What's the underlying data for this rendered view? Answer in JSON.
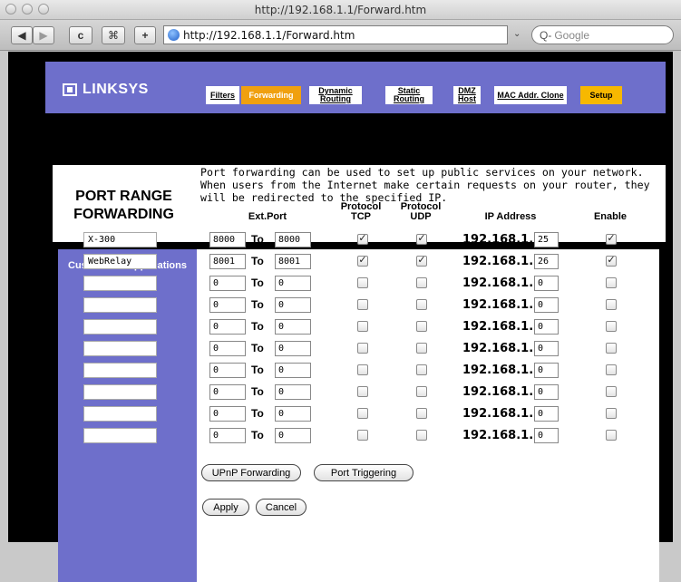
{
  "browser": {
    "title": "http://192.168.1.1/Forward.htm",
    "url": "http://192.168.1.1/Forward.htm",
    "search_placeholder": "Google",
    "buttons": {
      "back": "◀",
      "forward": "▶",
      "reload": "c",
      "bookmark": "⌘",
      "add": "+"
    }
  },
  "brand": {
    "logo_text": "LINKSYS"
  },
  "tabs": [
    {
      "label": "Filters"
    },
    {
      "label": "Forwarding"
    },
    {
      "label": "Dynamic Routing"
    },
    {
      "label": "Static Routing"
    },
    {
      "label": "DMZ Host"
    },
    {
      "label": "MAC Addr. Clone"
    },
    {
      "label": "Setup"
    }
  ],
  "page": {
    "title_line1": "PORT RANGE",
    "title_line2": "FORWARDING",
    "description": "Port forwarding can be used to set up public services on your network. When users from the Internet make certain requests on your router, they will be redirected to the specified IP."
  },
  "table": {
    "side_label": "Customized Applications",
    "headers": {
      "ext_port": "Ext.Port",
      "tcp_line1": "Protocol",
      "tcp_line2": "TCP",
      "udp_line1": "Protocol",
      "udp_line2": "UDP",
      "ip": "IP Address",
      "enable": "Enable"
    },
    "to_label": "To",
    "ip_prefix": "192.168.1.",
    "rows": [
      {
        "app": "X-300",
        "from": "8000",
        "to": "8000",
        "tcp": true,
        "udp": true,
        "ip": "25",
        "enable": true
      },
      {
        "app": "WebRelay",
        "from": "8001",
        "to": "8001",
        "tcp": true,
        "udp": true,
        "ip": "26",
        "enable": true
      },
      {
        "app": "",
        "from": "0",
        "to": "0",
        "tcp": false,
        "udp": false,
        "ip": "0",
        "enable": false
      },
      {
        "app": "",
        "from": "0",
        "to": "0",
        "tcp": false,
        "udp": false,
        "ip": "0",
        "enable": false
      },
      {
        "app": "",
        "from": "0",
        "to": "0",
        "tcp": false,
        "udp": false,
        "ip": "0",
        "enable": false
      },
      {
        "app": "",
        "from": "0",
        "to": "0",
        "tcp": false,
        "udp": false,
        "ip": "0",
        "enable": false
      },
      {
        "app": "",
        "from": "0",
        "to": "0",
        "tcp": false,
        "udp": false,
        "ip": "0",
        "enable": false
      },
      {
        "app": "",
        "from": "0",
        "to": "0",
        "tcp": false,
        "udp": false,
        "ip": "0",
        "enable": false
      },
      {
        "app": "",
        "from": "0",
        "to": "0",
        "tcp": false,
        "udp": false,
        "ip": "0",
        "enable": false
      },
      {
        "app": "",
        "from": "0",
        "to": "0",
        "tcp": false,
        "udp": false,
        "ip": "0",
        "enable": false
      }
    ]
  },
  "actions": {
    "upnp": "UPnP Forwarding",
    "port_triggering": "Port Triggering",
    "apply": "Apply",
    "cancel": "Cancel"
  }
}
